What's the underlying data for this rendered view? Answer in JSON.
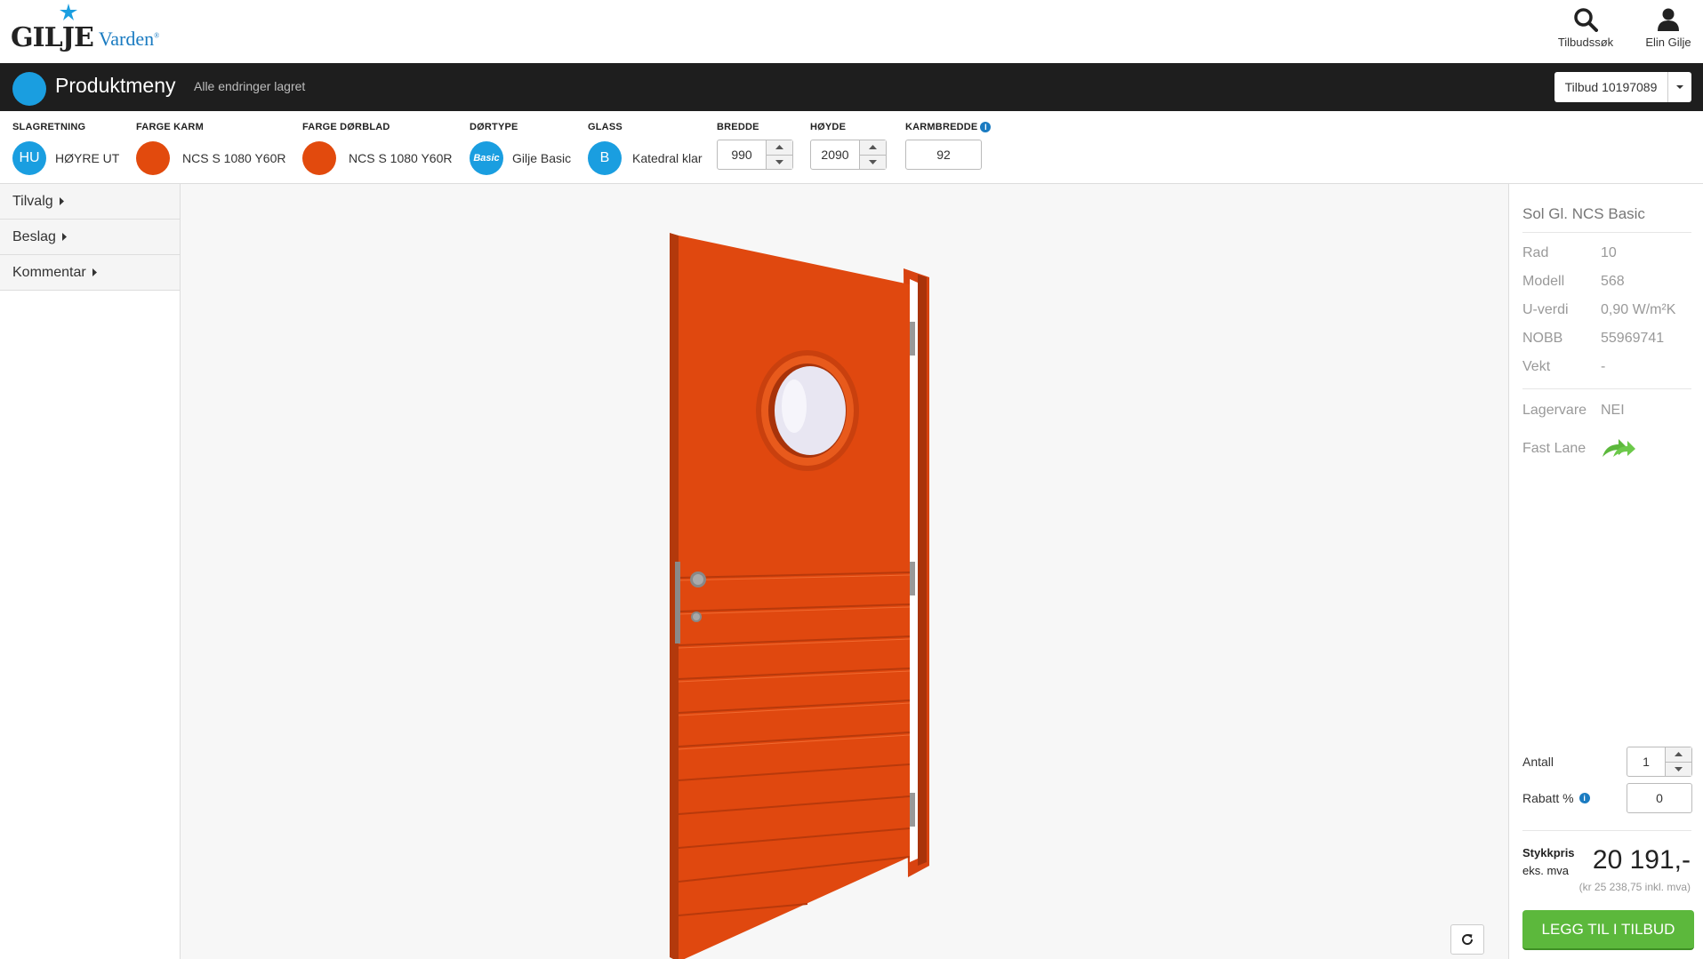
{
  "brand": {
    "name_main": "GILJE",
    "name_sub": "Varden",
    "trademark": "®",
    "accent_color": "#1a9ee0"
  },
  "header_actions": [
    {
      "label": "Tilbudssøk",
      "icon": "search-icon"
    },
    {
      "label": "Elin Gilje",
      "icon": "user-icon"
    }
  ],
  "navbar": {
    "title": "Produktmeny",
    "status": "Alle endringer lagret",
    "offer_label": "Tilbud 10197089"
  },
  "options": {
    "slagretning": {
      "label": "SLAGRETNING",
      "badge": "HU",
      "value": "HØYRE UT"
    },
    "farge_karm": {
      "label": "FARGE KARM",
      "value": "NCS S 1080 Y60R",
      "color": "#e24a0d"
    },
    "farge_dorblad": {
      "label": "FARGE DØRBLAD",
      "value": "NCS S 1080 Y60R",
      "color": "#e24a0d"
    },
    "dortype": {
      "label": "DØRTYPE",
      "badge": "Basic",
      "value": "Gilje Basic"
    },
    "glass": {
      "label": "GLASS",
      "badge": "B",
      "value": "Katedral klar"
    },
    "bredde": {
      "label": "BREDDE",
      "value": "990"
    },
    "hoyde": {
      "label": "HØYDE",
      "value": "2090"
    },
    "karmbredde": {
      "label": "KARMBREDDE",
      "value": "92",
      "info": "i"
    }
  },
  "sidebar": {
    "items": [
      {
        "label": "Tilvalg"
      },
      {
        "label": "Beslag"
      },
      {
        "label": "Kommentar"
      }
    ]
  },
  "product": {
    "name": "Sol Gl. NCS Basic",
    "specs": [
      {
        "key": "Rad",
        "value": "10"
      },
      {
        "key": "Modell",
        "value": "568"
      },
      {
        "key": "U-verdi",
        "value": "0,90 W/m²K"
      },
      {
        "key": "NOBB",
        "value": "55969741"
      },
      {
        "key": "Vekt",
        "value": "-"
      }
    ],
    "lagervare": {
      "key": "Lagervare",
      "value": "NEI"
    },
    "fast_lane": {
      "key": "Fast Lane",
      "icon": "fast-lane-arrows-icon",
      "color": "#5cb83c"
    },
    "antall": {
      "label": "Antall",
      "value": "1"
    },
    "rabatt": {
      "label": "Rabatt %",
      "value": "0",
      "info": "i"
    },
    "price": {
      "label_bold": "Stykkpris",
      "label_sub": "eks. mva",
      "value": "20 191,-",
      "inkl": "(kr 25 238,75 inkl. mva)"
    },
    "add_button": "LEGG TIL I TILBUD"
  },
  "viewer": {
    "door_color": "#e24a0d",
    "refresh_icon": "refresh-icon"
  }
}
